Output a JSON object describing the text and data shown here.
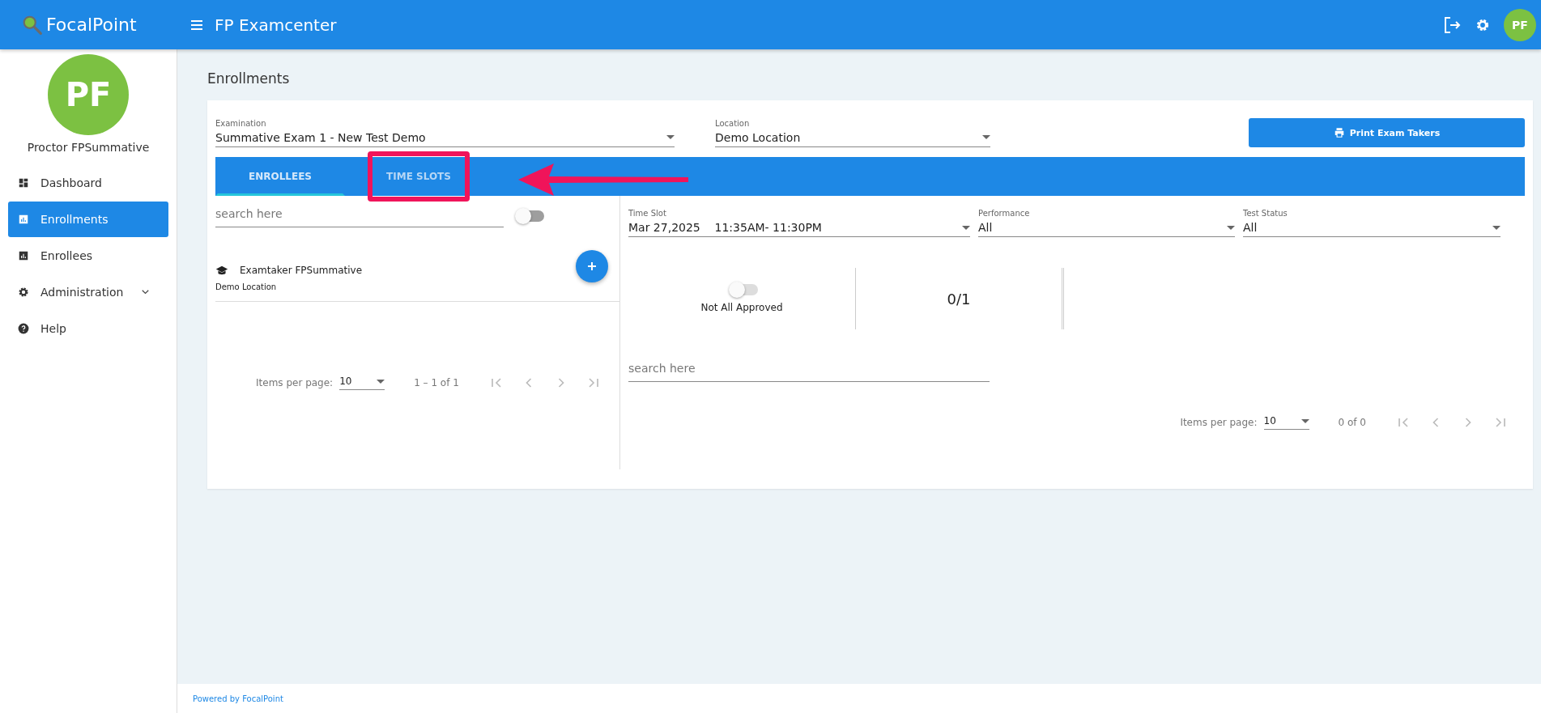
{
  "header": {
    "logo": "FocalPoint",
    "title": "FP Examcenter",
    "avatar": "PF"
  },
  "sidebar": {
    "avatar": "PF",
    "user": "Proctor FPSummative",
    "items": [
      {
        "label": "Dashboard",
        "kind": "dashboard",
        "selected": false,
        "expandable": false
      },
      {
        "label": "Enrollments",
        "kind": "chart",
        "selected": true,
        "expandable": false
      },
      {
        "label": "Enrollees",
        "kind": "chart",
        "selected": false,
        "expandable": false
      },
      {
        "label": "Administration",
        "kind": "gear",
        "selected": false,
        "expandable": true
      },
      {
        "label": "Help",
        "kind": "help",
        "selected": false,
        "expandable": false
      }
    ]
  },
  "page_title": "Enrollments",
  "filters": [
    {
      "label": "Examination",
      "value": "Summative Exam 1 - New Test Demo"
    },
    {
      "label": "Location",
      "value": "Demo Location"
    }
  ],
  "print_button": "Print Exam Takers",
  "tabs": [
    {
      "label": "ENROLLEES",
      "selected": true,
      "highlighted": false
    },
    {
      "label": "TIME SLOTS",
      "selected": false,
      "highlighted": true
    }
  ],
  "enrollees_panel": {
    "search": {
      "placeholder": "search here"
    },
    "toggle": {
      "on": false
    },
    "items": [
      {
        "name": "Examtaker FPSummative",
        "location": "Demo Location"
      }
    ],
    "paginator": {
      "label": "Items per page:",
      "page_size": "10",
      "range": "1 – 1 of 1",
      "nav_disabled": true
    }
  },
  "time_slots_panel": {
    "filters": [
      {
        "label": "Time Slot",
        "value": "Mar 27,2025    11:35AM- 11:30PM"
      },
      {
        "label": "Performance",
        "value": "All"
      },
      {
        "label": "Test Status",
        "value": "All"
      }
    ],
    "approval_toggle": {
      "on": false,
      "label": "Not All Approved"
    },
    "count": "0/1",
    "search": {
      "placeholder": "search here"
    },
    "paginator": {
      "label": "Items per page:",
      "page_size": "10",
      "range": "0 of 0",
      "nav_disabled": true
    }
  },
  "footer": "Powered by FocalPoint"
}
